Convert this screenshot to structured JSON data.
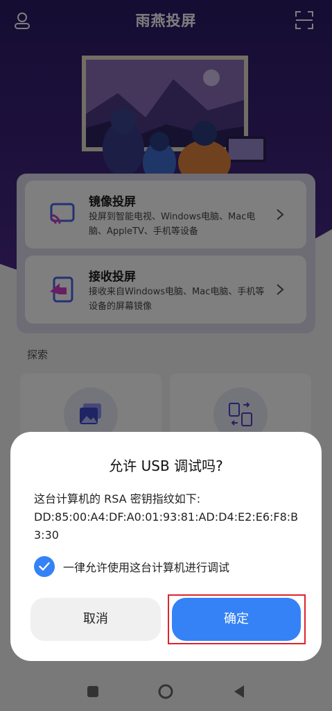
{
  "app": {
    "title": "雨燕投屏",
    "cards": [
      {
        "title": "镜像投屏",
        "desc": "投屏到智能电视、Windows电脑、Mac电脑、AppleTV、手机等设备"
      },
      {
        "title": "接收投屏",
        "desc": "接收来自Windows电脑、Mac电脑、手机等设备的屏幕镜像"
      }
    ],
    "explore_label": "探索"
  },
  "dialog": {
    "title": "允许 USB 调试吗?",
    "message": "这台计算机的 RSA 密钥指纹如下:",
    "fingerprint": "DD:85:00:A4:DF:A0:01:93:81:AD:D4:E2:E6:F8:B3:30",
    "checkbox_label": "一律允许使用这台计算机进行调试",
    "checkbox_checked": true,
    "cancel_label": "取消",
    "ok_label": "确定"
  },
  "colors": {
    "hero_purple": "#3b2174",
    "accent_blue": "#3482f6",
    "highlight_red": "#e0222b"
  },
  "icons": [
    "user-icon",
    "scan-icon",
    "cast-icon",
    "receive-icon",
    "chevron-right-icon",
    "gallery-icon",
    "file-transfer-icon",
    "check-icon",
    "nav-recent-icon",
    "nav-home-icon",
    "nav-back-icon"
  ]
}
